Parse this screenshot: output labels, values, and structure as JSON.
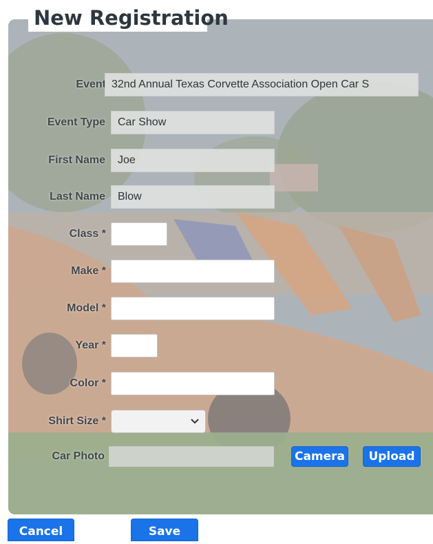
{
  "title": "New Registration",
  "fields": {
    "event": {
      "label": "Event",
      "value": "32nd Annual Texas Corvette Association Open Car S"
    },
    "event_type": {
      "label": "Event Type",
      "value": "Car Show"
    },
    "first_name": {
      "label": "First Name",
      "value": "Joe"
    },
    "last_name": {
      "label": "Last Name",
      "value": "Blow"
    },
    "class": {
      "label": "Class *",
      "value": ""
    },
    "make": {
      "label": "Make *",
      "value": ""
    },
    "model": {
      "label": "Model *",
      "value": ""
    },
    "year": {
      "label": "Year *",
      "value": ""
    },
    "color": {
      "label": "Color *",
      "value": ""
    },
    "shirt_size": {
      "label": "Shirt Size *",
      "value": ""
    },
    "car_photo": {
      "label": "Car Photo",
      "value": ""
    }
  },
  "buttons": {
    "camera": "Camera",
    "upload": "Upload",
    "cancel": "Cancel",
    "save": "Save"
  },
  "colors": {
    "primary": "#1a73e8",
    "title": "#2d3740"
  }
}
